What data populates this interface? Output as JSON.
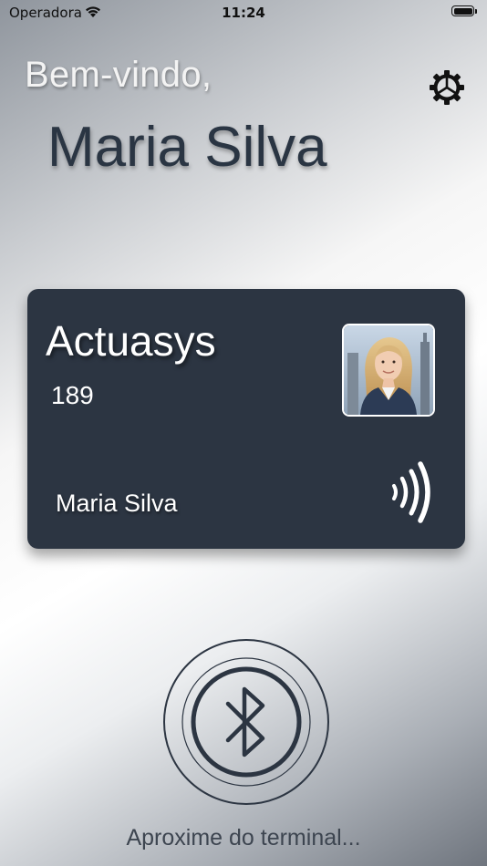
{
  "status_bar": {
    "carrier": "Operadora",
    "time": "11:24",
    "wifi_icon": "wifi-icon",
    "battery_icon": "battery-icon"
  },
  "header": {
    "greeting": "Bem-vindo,",
    "user_name": "Maria Silva",
    "settings_icon": "gear-icon"
  },
  "card": {
    "company": "Actuasys",
    "id_number": "189",
    "holder_name": "Maria Silva",
    "photo": "profile-photo",
    "contactless_icon": "contactless-icon",
    "background_color": "#2c3542"
  },
  "bluetooth": {
    "icon": "bluetooth-icon",
    "status_text": "Aproxime do terminal..."
  }
}
